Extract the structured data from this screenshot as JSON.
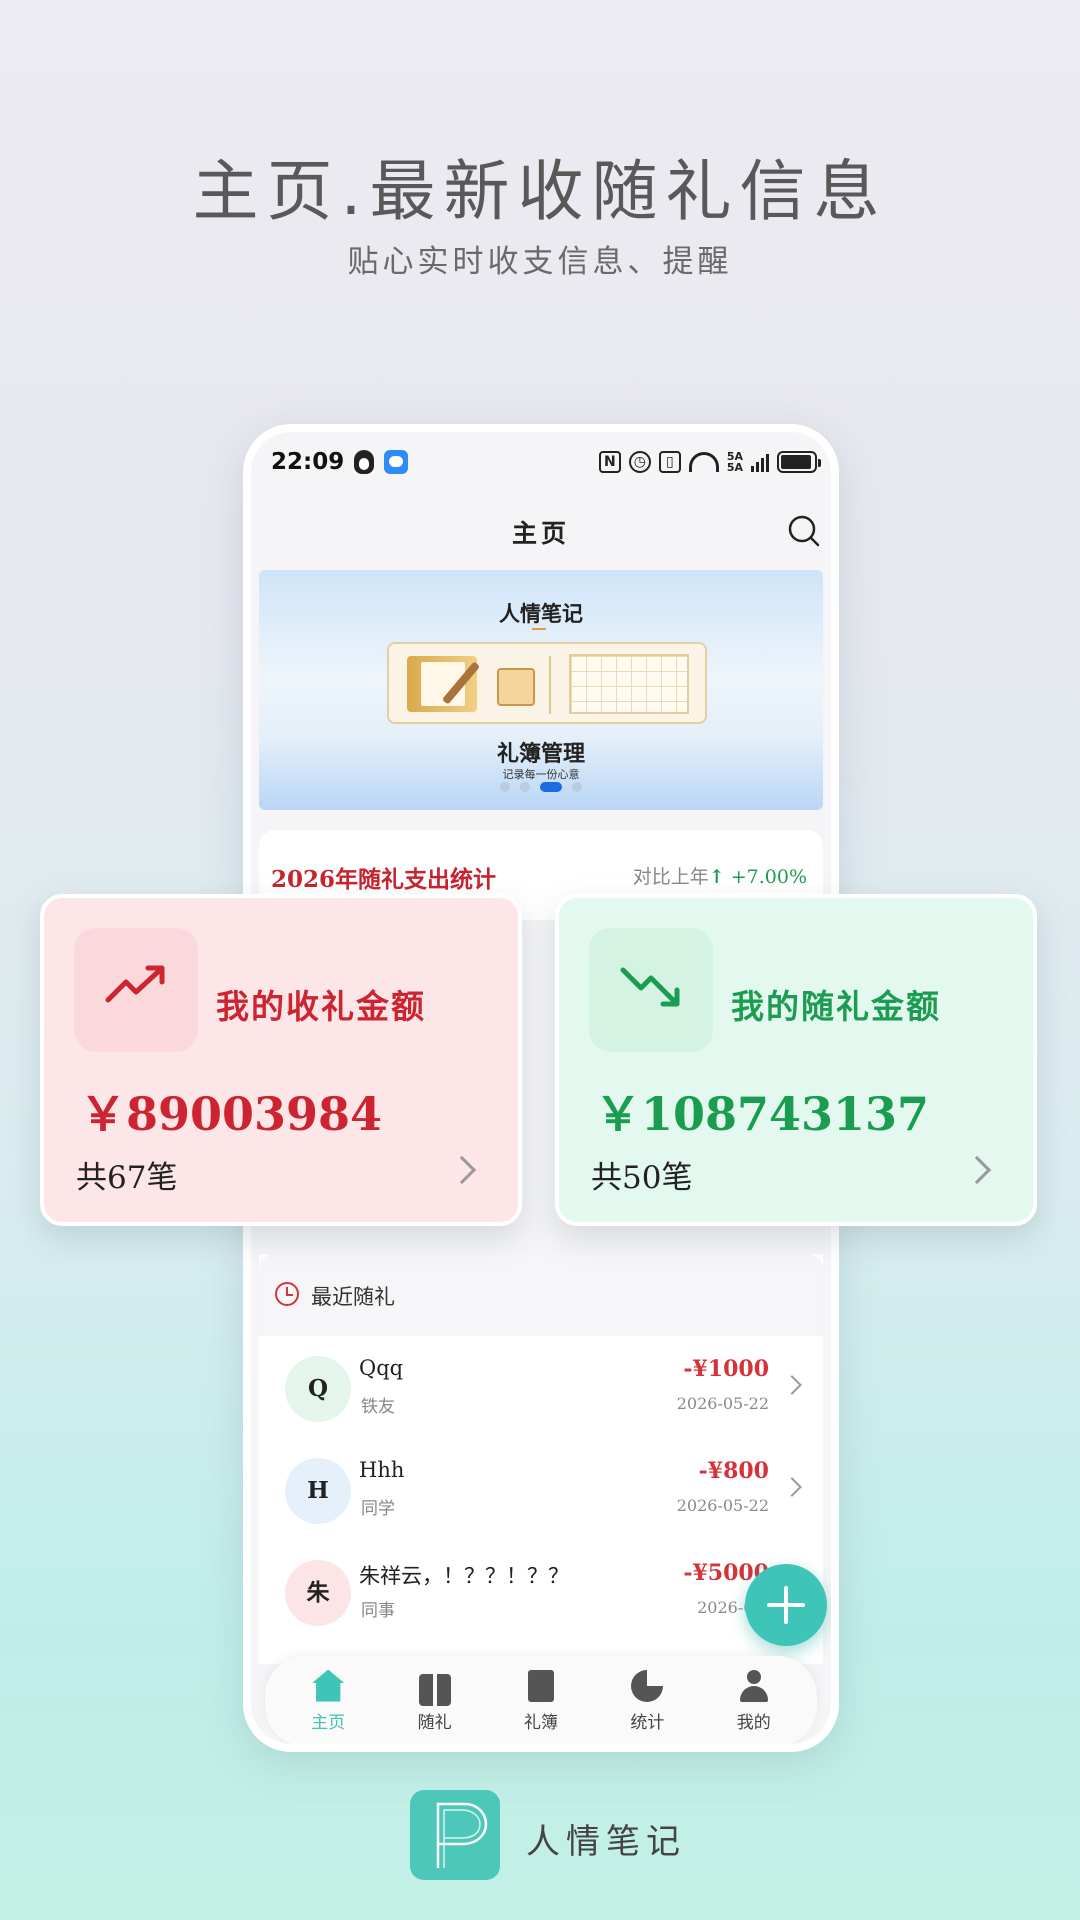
{
  "headline": "主页.最新收随礼信息",
  "subhead": "贴心实时收支信息、提醒",
  "status_bar": {
    "time": "22:09",
    "signal_label_1": "5A",
    "signal_label_2": "5A"
  },
  "title_bar": {
    "title": "主页"
  },
  "banner": {
    "title": "人情笔记",
    "main": "礼簿管理",
    "sub": "记录每一份心意",
    "active_dot": 2
  },
  "stats": {
    "title": "2026年随礼支出统计",
    "compare_label": "对比上年",
    "compare_arrow": "↑",
    "compare_pct": "+7.00%"
  },
  "received_card": {
    "label": "我的收礼金额",
    "amount": "￥89003984",
    "count": "共67笔",
    "color": "#cc2430"
  },
  "given_card": {
    "label": "我的随礼金额",
    "amount": "￥108743137",
    "count": "共50笔",
    "color": "#1a9d50"
  },
  "recent": {
    "title": "最近随礼",
    "items": [
      {
        "avatar": "Q",
        "name": "Qqq",
        "relation": "铁友",
        "amount": "-¥1000",
        "date": "2026-05-22",
        "avatar_bg": "#e4f5ec"
      },
      {
        "avatar": "H",
        "name": "Hhh",
        "relation": "同学",
        "amount": "-¥800",
        "date": "2026-05-22",
        "avatar_bg": "#e6f0fb"
      },
      {
        "avatar": "朱",
        "name": "朱祥云，！？？！？？",
        "relation": "同事",
        "amount": "-¥5000",
        "date": "2026-05-",
        "avatar_bg": "#fde4e6"
      }
    ]
  },
  "tabs": [
    {
      "label": "主页",
      "icon": "home-icon",
      "active": true
    },
    {
      "label": "随礼",
      "icon": "gift-icon",
      "active": false
    },
    {
      "label": "礼簿",
      "icon": "book-icon",
      "active": false
    },
    {
      "label": "统计",
      "icon": "pie-chart-icon",
      "active": false
    },
    {
      "label": "我的",
      "icon": "user-icon",
      "active": false
    }
  ],
  "brand": {
    "name": "人情笔记",
    "logo_letter": "P"
  },
  "colors": {
    "accent": "#3fc4b8",
    "red": "#cc2430",
    "green": "#1a9d50"
  }
}
